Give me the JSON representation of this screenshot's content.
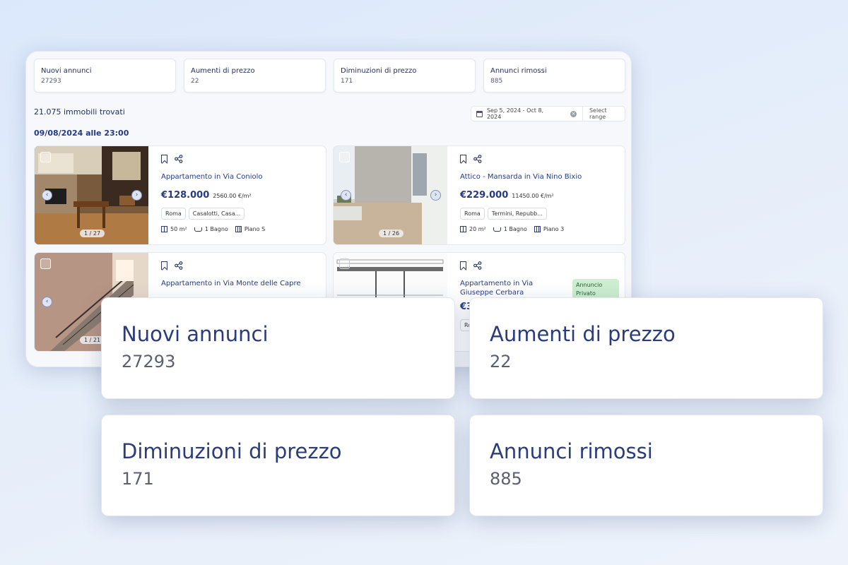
{
  "stats": [
    {
      "title": "Nuovi annunci",
      "value": "27293"
    },
    {
      "title": "Aumenti di prezzo",
      "value": "22"
    },
    {
      "title": "Diminuzioni di prezzo",
      "value": "171"
    },
    {
      "title": "Annunci rimossi",
      "value": "885"
    }
  ],
  "results_text": "21.075 immobili trovati",
  "date_heading": "09/08/2024 alle 23:00",
  "date_range": {
    "value": "Sep 5, 2024 - Oct 8, 2024",
    "select_label": "Select range"
  },
  "listings": [
    {
      "title": "Appartamento in Via Coniolo",
      "price": "€128.000",
      "price_per_m2": "2560.00 €/m²",
      "tags": [
        "Roma",
        "Casalotti, Casa..."
      ],
      "area": "50 m²",
      "bath": "1 Bagno",
      "floor": "Piano S",
      "counter": "1 / 27"
    },
    {
      "title": "Attico - Mansarda in Via Nino Bixio",
      "price": "€229.000",
      "price_per_m2": "11450.00 €/m²",
      "tags": [
        "Roma",
        "Termini, Repubb..."
      ],
      "area": "20 m²",
      "bath": "1 Bagno",
      "floor": "Piano 3",
      "counter": "1 / 26"
    },
    {
      "title": "Appartamento in Via Monte delle Capre",
      "counter": "1 / 21"
    },
    {
      "title": "Appartamento in Via Giuseppe Cerbara",
      "price_partial": "€3",
      "tag_partial": "Ro",
      "badge": "Annuncio Privato"
    }
  ],
  "icons": {
    "bookmark": "bookmark-icon",
    "share": "share-icon",
    "area": "area-icon",
    "bath": "bathtub-icon",
    "floor": "floor-icon",
    "calendar": "calendar-icon"
  },
  "colors": {
    "accent": "#233b86",
    "private_badge": "#cdeecf"
  }
}
